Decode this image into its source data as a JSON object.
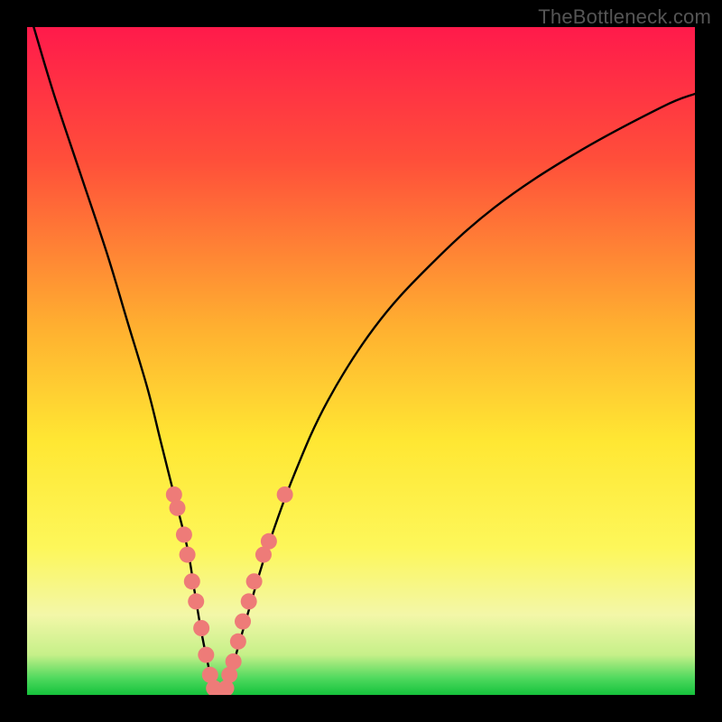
{
  "watermark": "TheBottleneck.com",
  "chart_data": {
    "type": "line",
    "title": "",
    "xlabel": "",
    "ylabel": "",
    "xlim": [
      0,
      100
    ],
    "ylim": [
      0,
      100
    ],
    "gradient_stops": [
      {
        "offset": 0.0,
        "color": "#ff1a4b"
      },
      {
        "offset": 0.2,
        "color": "#ff4f3a"
      },
      {
        "offset": 0.45,
        "color": "#ffb030"
      },
      {
        "offset": 0.62,
        "color": "#ffe733"
      },
      {
        "offset": 0.78,
        "color": "#fdf75a"
      },
      {
        "offset": 0.88,
        "color": "#f3f7a8"
      },
      {
        "offset": 0.94,
        "color": "#c6f089"
      },
      {
        "offset": 0.975,
        "color": "#4fd95e"
      },
      {
        "offset": 1.0,
        "color": "#15c23c"
      }
    ],
    "series": [
      {
        "name": "bottleneck-curve",
        "x": [
          1,
          4,
          8,
          12,
          15,
          18,
          20,
          22,
          24,
          25,
          26,
          27,
          28,
          29,
          30,
          31,
          33,
          36,
          40,
          45,
          52,
          60,
          70,
          82,
          95,
          100
        ],
        "y": [
          100,
          90,
          78,
          66,
          56,
          46,
          38,
          30,
          22,
          16,
          10,
          5,
          1,
          0,
          1,
          5,
          12,
          22,
          33,
          44,
          55,
          64,
          73,
          81,
          88,
          90
        ]
      }
    ],
    "markers": {
      "name": "highlight-dots",
      "color": "#ee7b78",
      "radius": 9,
      "points": [
        {
          "x": 22.0,
          "y": 30
        },
        {
          "x": 22.5,
          "y": 28
        },
        {
          "x": 23.5,
          "y": 24
        },
        {
          "x": 24.0,
          "y": 21
        },
        {
          "x": 24.7,
          "y": 17
        },
        {
          "x": 25.3,
          "y": 14
        },
        {
          "x": 26.1,
          "y": 10
        },
        {
          "x": 26.8,
          "y": 6
        },
        {
          "x": 27.4,
          "y": 3
        },
        {
          "x": 28.0,
          "y": 1
        },
        {
          "x": 28.5,
          "y": 0
        },
        {
          "x": 29.2,
          "y": 0
        },
        {
          "x": 29.8,
          "y": 1
        },
        {
          "x": 30.3,
          "y": 3
        },
        {
          "x": 30.9,
          "y": 5
        },
        {
          "x": 31.6,
          "y": 8
        },
        {
          "x": 32.3,
          "y": 11
        },
        {
          "x": 33.2,
          "y": 14
        },
        {
          "x": 34.0,
          "y": 17
        },
        {
          "x": 35.4,
          "y": 21
        },
        {
          "x": 36.2,
          "y": 23
        },
        {
          "x": 38.6,
          "y": 30
        }
      ]
    }
  }
}
